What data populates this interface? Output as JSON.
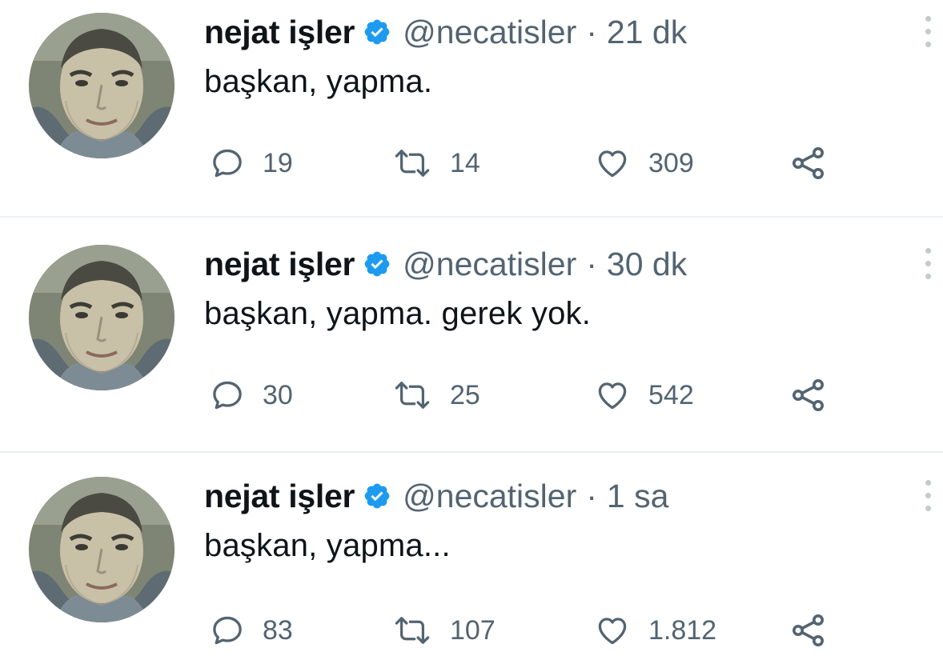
{
  "tweets": [
    {
      "author_name": "nejat işler",
      "handle": "@necatisler",
      "separator": "·",
      "time": "21 dk",
      "text": "başkan, yapma.",
      "replies": "19",
      "retweets": "14",
      "likes": "309"
    },
    {
      "author_name": "nejat işler",
      "handle": "@necatisler",
      "separator": "·",
      "time": "30 dk",
      "text": "başkan, yapma. gerek yok.",
      "replies": "30",
      "retweets": "25",
      "likes": "542"
    },
    {
      "author_name": "nejat işler",
      "handle": "@necatisler",
      "separator": "·",
      "time": "1 sa",
      "text": "başkan, yapma...",
      "replies": "83",
      "retweets": "107",
      "likes": "1.812"
    }
  ],
  "icons": {
    "verified": "verified-badge-icon",
    "reply": "reply-bubble-icon",
    "retweet": "retweet-icon",
    "like": "heart-icon",
    "share": "share-nodes-icon",
    "more": "more-vertical-dots-icon"
  },
  "colors": {
    "verified_blue": "#1d9bf0",
    "secondary_text": "#536471",
    "primary_text": "#0f1419",
    "divider": "#eceff1"
  }
}
